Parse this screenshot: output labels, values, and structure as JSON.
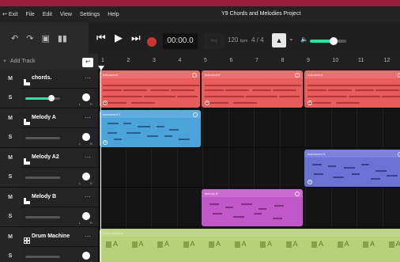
{
  "menu": {
    "exit_label": "Exit",
    "items": [
      "File",
      "Edit",
      "View",
      "Settings",
      "Help"
    ],
    "project_title": "Y9 Chords and Melodies Project"
  },
  "toolbar": {
    "undo_icon": "undo-icon",
    "redo_icon": "redo-icon",
    "time": "00:00.0",
    "key": "Key",
    "tempo_value": "120",
    "tempo_unit": "bpm",
    "time_signature": "4 / 4",
    "master_volume": 0.65
  },
  "sidebar": {
    "add_track_label": "Add Track"
  },
  "ruler": {
    "bars": [
      "1",
      "2",
      "3",
      "4",
      "5",
      "6",
      "7",
      "8",
      "9",
      "10",
      "11",
      "12"
    ]
  },
  "tracks": [
    {
      "name": "chords.",
      "mute": "M",
      "solo": "S",
      "more": "…",
      "volume": 0.75,
      "color": "#e85c5c",
      "icon": "instrument-icon",
      "pan_l": "L",
      "pan_r": "R"
    },
    {
      "name": "Melody A",
      "mute": "M",
      "solo": "S",
      "more": "…",
      "volume": 0.0,
      "color": "#4aa3d9",
      "icon": "instrument-icon",
      "pan_l": "L",
      "pan_r": "R"
    },
    {
      "name": "Melody A2",
      "mute": "M",
      "solo": "S",
      "more": "…",
      "volume": 0.0,
      "color": "#6b72d6",
      "icon": "instrument-icon",
      "pan_l": "L",
      "pan_r": "R"
    },
    {
      "name": "Melody B",
      "mute": "M",
      "solo": "S",
      "more": "…",
      "volume": 0.0,
      "color": "#c257c9",
      "icon": "instrument-icon",
      "pan_l": "L",
      "pan_r": "R"
    },
    {
      "name": "Drum Machine",
      "mute": "M",
      "solo": "S",
      "more": "…",
      "volume": 0.0,
      "color": "#b8d07a",
      "icon": "drum-machine-icon",
      "pan_l": "L",
      "pan_r": "R"
    }
  ],
  "clips": {
    "chords": [
      {
        "label": "Instrument"
      },
      {
        "label": "Instrument"
      },
      {
        "label": "Instrument"
      }
    ],
    "melody_a": {
      "label": "Instrument 2"
    },
    "melody_a2": {
      "label": "Instrument 3"
    },
    "melody_b": {
      "label": "Melody B"
    },
    "drum": {
      "label": "Drum Machine",
      "pad_letter": "A"
    }
  }
}
